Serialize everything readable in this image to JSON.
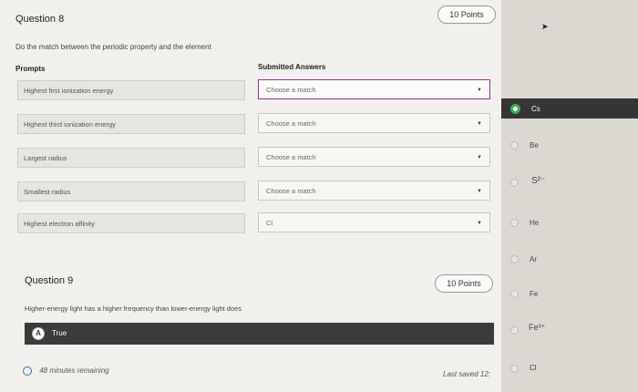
{
  "question8": {
    "title": "Question 8",
    "points": "10 Points",
    "instruction": "Do the match between the periodic property and the element",
    "prompts_header": "Prompts",
    "answers_header": "Submitted Answers",
    "rows": [
      {
        "prompt": "Highest first ionization energy",
        "answer": "Choose a match"
      },
      {
        "prompt": "Highest third ionization energy",
        "answer": "Choose a match"
      },
      {
        "prompt": "Largest radius",
        "answer": "Choose a match"
      },
      {
        "prompt": "Smallest radius",
        "answer": "Choose a match"
      },
      {
        "prompt": "Highest electron affinity",
        "answer": "Cl"
      }
    ]
  },
  "question9": {
    "title": "Question 9",
    "points": "10 Points",
    "text": "Higher-energy light has a higher frequency than lower-energy light does",
    "option_a_letter": "A",
    "option_a_label": "True"
  },
  "footer": {
    "timer": "48 minutes remaining",
    "last_saved": "Last saved 12:"
  },
  "dropdown_options": [
    {
      "label": "Cs",
      "selected": true
    },
    {
      "label": "Be"
    },
    {
      "label": "S²⁻"
    },
    {
      "label": "He"
    },
    {
      "label": "Ar"
    },
    {
      "label": "Fe"
    },
    {
      "label": "Fe³⁺"
    },
    {
      "label": "Cl"
    }
  ],
  "colors": {
    "accent": "#a42d8e",
    "selected_radio": "#37b24d",
    "dark_bar": "#3b3b3b"
  }
}
